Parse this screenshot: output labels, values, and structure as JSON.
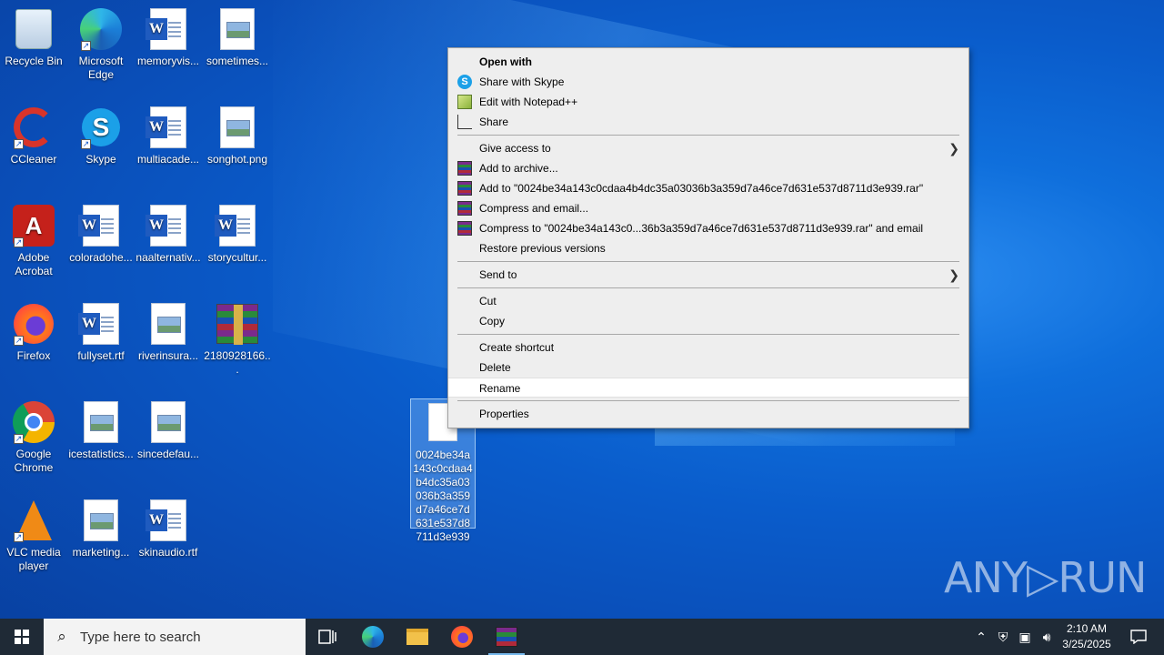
{
  "desktop": {
    "icons": [
      {
        "label": "Recycle Bin",
        "icon": "recycle-bin-icon"
      },
      {
        "label": "Microsoft Edge",
        "icon": "edge-icon"
      },
      {
        "label": "memoryvis...",
        "icon": "word-document-icon"
      },
      {
        "label": "sometimes...",
        "icon": "image-file-icon"
      },
      {
        "label": "CCleaner",
        "icon": "ccleaner-icon"
      },
      {
        "label": "Skype",
        "icon": "skype-icon"
      },
      {
        "label": "multiacade...",
        "icon": "word-document-icon"
      },
      {
        "label": "songhot.png",
        "icon": "image-file-icon"
      },
      {
        "label": "Adobe Acrobat",
        "icon": "acrobat-icon"
      },
      {
        "label": "coloradohe...",
        "icon": "word-document-icon"
      },
      {
        "label": "naalternativ...",
        "icon": "word-document-icon"
      },
      {
        "label": "storycultur...",
        "icon": "word-document-icon"
      },
      {
        "label": "Firefox",
        "icon": "firefox-icon"
      },
      {
        "label": "fullyset.rtf",
        "icon": "word-document-icon"
      },
      {
        "label": "riverinsura...",
        "icon": "image-file-icon"
      },
      {
        "label": "2180928166...",
        "icon": "winrar-archive-icon"
      },
      {
        "label": "Google Chrome",
        "icon": "chrome-icon"
      },
      {
        "label": "icestatistics...",
        "icon": "image-file-icon"
      },
      {
        "label": "sincedefau...",
        "icon": "image-file-icon"
      },
      {
        "label": "VLC media player",
        "icon": "vlc-icon"
      },
      {
        "label": "marketing...",
        "icon": "image-file-icon"
      },
      {
        "label": "skinaudio.rtf",
        "icon": "word-document-icon"
      }
    ],
    "selected_file": {
      "label": "0024be34a143c0cdaa4b4dc35a03036b3a359d7a46ce7d631e537d8711d3e939"
    }
  },
  "context_menu": {
    "open_with": "Open with",
    "share_skype": "Share with Skype",
    "edit_notepad": "Edit with Notepad++",
    "share": "Share",
    "give_access": "Give access to",
    "add_archive": "Add to archive...",
    "add_to_rar": "Add to \"0024be34a143c0cdaa4b4dc35a03036b3a359d7a46ce7d631e537d8711d3e939.rar\"",
    "compress_email": "Compress and email...",
    "compress_to_rar_email": "Compress to \"0024be34a143c0...36b3a359d7a46ce7d631e537d8711d3e939.rar\" and email",
    "restore_versions": "Restore previous versions",
    "send_to": "Send to",
    "cut": "Cut",
    "copy": "Copy",
    "create_shortcut": "Create shortcut",
    "delete": "Delete",
    "rename": "Rename",
    "properties": "Properties"
  },
  "watermark": "ANY▷RUN",
  "taskbar": {
    "search_placeholder": "Type here to search",
    "time": "2:10 AM",
    "date": "3/25/2025"
  }
}
